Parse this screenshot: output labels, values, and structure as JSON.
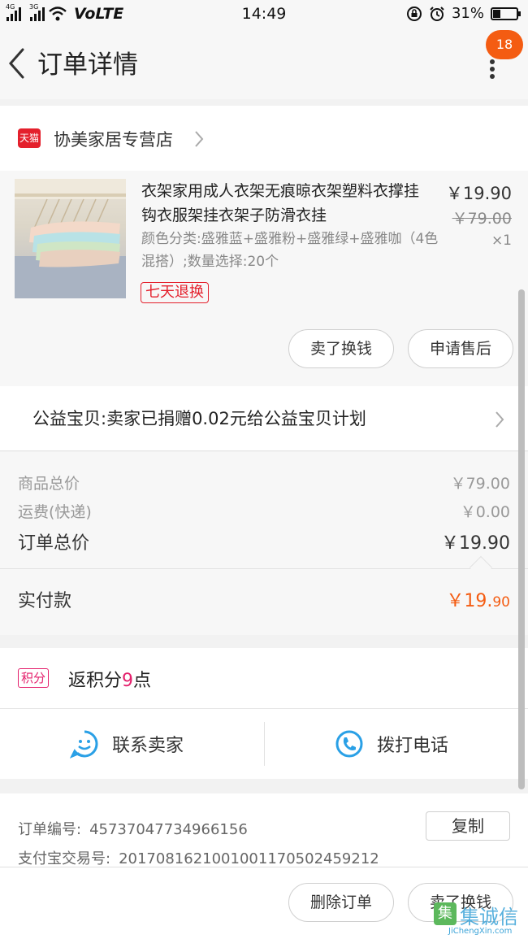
{
  "status_bar": {
    "network_1": "4G",
    "network_2": "3G",
    "volte": "VoLTE",
    "time": "14:49",
    "battery": "31%"
  },
  "header": {
    "title": "订单详情",
    "badge_count": "18"
  },
  "shop": {
    "platform_tag": "天猫",
    "name": "协美家居专营店"
  },
  "product": {
    "title": "衣架家用成人衣架无痕晾衣架塑料衣撑挂钩衣服架挂衣架子防滑衣挂",
    "sku": "颜色分类:盛雅蓝+盛雅粉+盛雅绿+盛雅咖（4色混搭）;数量选择:20个",
    "price": "￥19.90",
    "original_price": "￥79.00",
    "quantity": "×1",
    "return_tag": "七天退换",
    "sell_button": "卖了换钱",
    "after_sale_button": "申请售后"
  },
  "charity": {
    "text": "公益宝贝:卖家已捐赠0.02元给公益宝贝计划"
  },
  "totals": {
    "goods_label": "商品总价",
    "goods_value": "￥79.00",
    "shipping_label": "运费(快递)",
    "shipping_value": "￥0.00",
    "order_total_label": "订单总价",
    "order_total_value": "￥19.90",
    "paid_label": "实付款",
    "paid_value_main": "￥19.",
    "paid_value_cents": "90"
  },
  "points": {
    "tag": "积分",
    "prefix": "返积分",
    "value": "9",
    "suffix": "点"
  },
  "contact": {
    "seller_label": "联系卖家",
    "phone_label": "拨打电话"
  },
  "order_info": {
    "order_no_label": "订单编号:",
    "order_no": "45737047734966156",
    "alipay_label": "支付宝交易号:",
    "alipay_no": "2017081621001001170502459212",
    "copy_button": "复制"
  },
  "bottom_bar": {
    "delete_button": "删除订单",
    "sell_button": "卖了换钱"
  },
  "watermark": {
    "text": "集诚信",
    "url": "JiChengXin.com"
  },
  "colors": {
    "accent_orange": "#f45c12",
    "tmall_red": "#e4202c",
    "points_pink": "#e4206c",
    "icon_blue": "#2aa0e6"
  }
}
